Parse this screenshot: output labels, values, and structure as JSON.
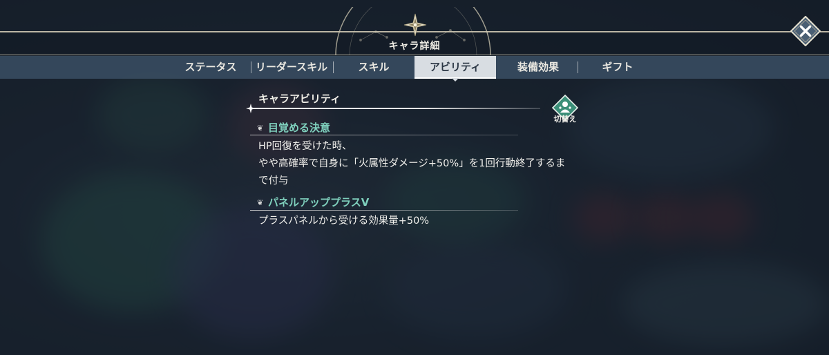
{
  "header": {
    "title": "キャラ詳細"
  },
  "controls": {
    "close_icon": "close-x-icon",
    "switch_label": "切替え"
  },
  "tabs": [
    {
      "label": "ステータス",
      "active": false
    },
    {
      "label": "リーダースキル",
      "active": false
    },
    {
      "label": "スキル",
      "active": false
    },
    {
      "label": "アビリティ",
      "active": true
    },
    {
      "label": "装備効果",
      "active": false
    },
    {
      "label": "ギフト",
      "active": false
    }
  ],
  "section": {
    "title": "キャラアビリティ"
  },
  "abilities": [
    {
      "name": "目覚める決意",
      "description": "HP回復を受けた時、\nやや高確率で自身に「火属性ダメージ+50%」を1回行動終了するま\nで付与"
    },
    {
      "name": "パネルアッププラスV",
      "description": "プラスパネルから受ける効果量+50%"
    }
  ],
  "colors": {
    "accent_teal": "#7fd0bd",
    "gold_line": "#cfc8b2",
    "tab_active_bg": "#d8dde2",
    "tab_bar_bg": "#374b60"
  }
}
